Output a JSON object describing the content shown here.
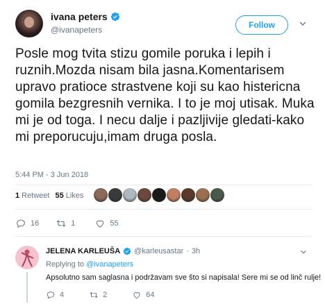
{
  "tweet": {
    "author_name": "ivana peters",
    "author_handle": "@ivanapeters",
    "follow_label": "Follow",
    "text": "Posle mog tvita stizu gomile poruka i lepih i ruznih.Mozda nisam bila jasna.Komentarisem upravo pratioce strastvene koji su kao histericna gomila bezgresnih vernika. I to je moj utisak. Muka mi je od toga. I necu dalje i pazljivije gledati-kako mi preporucuju,imam druga posla.",
    "timestamp": "5:44 PM - 3 Jun 2018",
    "retweet_count": "1",
    "retweet_label": "Retweet",
    "like_count": "55",
    "like_label": "Likes",
    "action_replies": "16",
    "action_retweets": "1",
    "action_likes": "55"
  },
  "likers": [
    "#8a6a5a",
    "#3a3a3a",
    "#b0b8c0",
    "#6a4a3a",
    "#1a1a1a",
    "#c08060",
    "#5a3a2a",
    "#9a7050",
    "#4a5a4a"
  ],
  "reply": {
    "author_name": "JELENA KARLEUŠA",
    "author_handle": "@karleusastar",
    "separator": "·",
    "age": "3h",
    "replying_prefix": "Replying to",
    "replying_to": "@ivanapeters",
    "text": "Apsolutno sam saglasna i podržavam sve što si napisala! Sere mi se od linč rulje!",
    "replies": "4",
    "retweets": "2",
    "likes": "64"
  },
  "colors": {
    "accent": "#1da1f2",
    "muted": "#657786",
    "text": "#14171a",
    "divider": "#e6ecf0"
  },
  "icons": [
    "verified-badge-icon",
    "chevron-down-icon",
    "reply-icon",
    "retweet-icon",
    "heart-icon"
  ]
}
